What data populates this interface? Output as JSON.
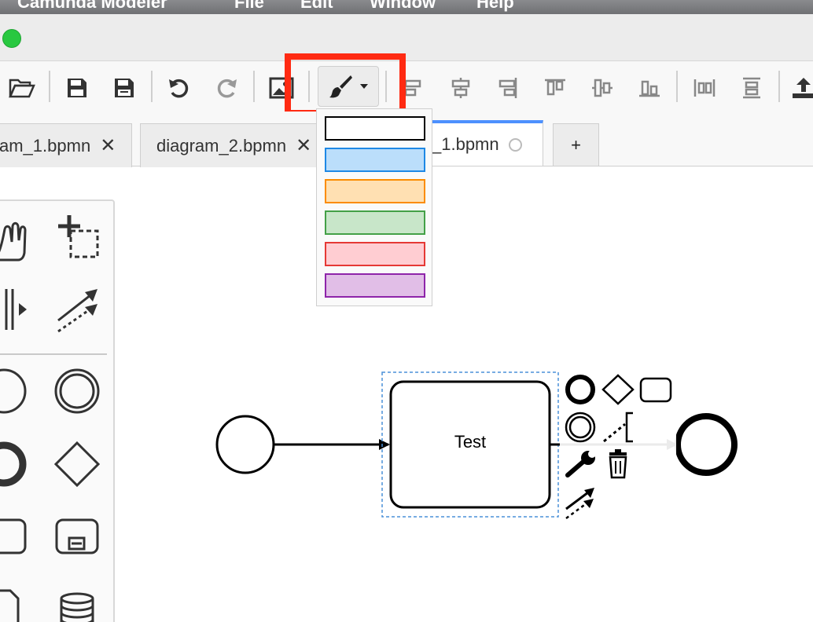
{
  "menubar": {
    "app_name": "Camunda Modeler",
    "items": [
      "File",
      "Edit",
      "Window",
      "Help"
    ]
  },
  "toolbar": {
    "buttons": [
      {
        "name": "open-file-icon"
      },
      {
        "name": "save-icon"
      },
      {
        "name": "save-as-icon"
      },
      {
        "name": "undo-icon"
      },
      {
        "name": "redo-icon"
      },
      {
        "name": "export-image-icon"
      },
      {
        "name": "paintbrush-icon"
      },
      {
        "name": "align-left-icon"
      },
      {
        "name": "align-center-icon"
      },
      {
        "name": "align-right-icon"
      },
      {
        "name": "align-top-icon"
      },
      {
        "name": "align-middle-icon"
      },
      {
        "name": "align-bottom-icon"
      },
      {
        "name": "distribute-horizontal-icon"
      },
      {
        "name": "distribute-vertical-icon"
      },
      {
        "name": "deploy-icon"
      }
    ]
  },
  "tabs": [
    {
      "label": "am_1.bpmn",
      "state": "close",
      "active": false
    },
    {
      "label": "diagram_2.bpmn",
      "state": "close",
      "active": false
    },
    {
      "label": "_1.bpmn",
      "state": "unsaved",
      "active": true
    }
  ],
  "tab_close_glyph": "✕",
  "tab_add_label": "+",
  "color_menu": {
    "swatches": [
      {
        "name": "default",
        "fill": "#ffffff",
        "stroke": "#000000"
      },
      {
        "name": "blue",
        "fill": "#bbdefb",
        "stroke": "#1e88e5"
      },
      {
        "name": "orange",
        "fill": "#ffe0b2",
        "stroke": "#fb8c00"
      },
      {
        "name": "green",
        "fill": "#c8e6c9",
        "stroke": "#43a047"
      },
      {
        "name": "red",
        "fill": "#ffcdd2",
        "stroke": "#e53935"
      },
      {
        "name": "purple",
        "fill": "#e1bee7",
        "stroke": "#8e24aa"
      }
    ]
  },
  "diagram": {
    "task_label": "Test"
  },
  "colors": {
    "highlight": "#ff2a12",
    "active_tab_accent": "#4d90fe",
    "selection": "#4a90d9"
  }
}
